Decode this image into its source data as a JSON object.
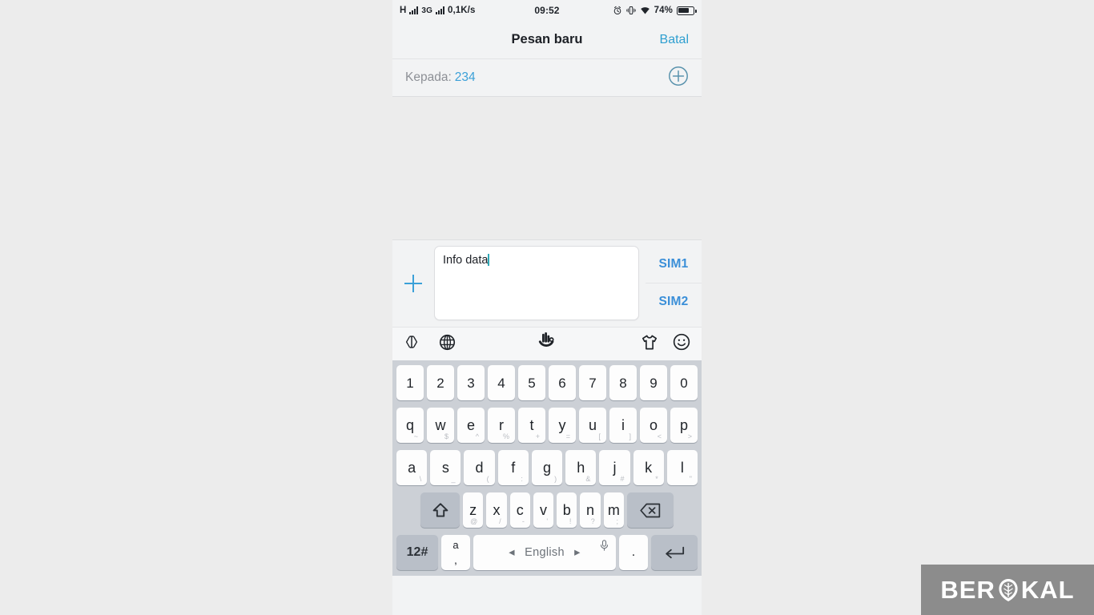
{
  "statusbar": {
    "network_type": "H",
    "network_gen": "3G",
    "data_rate": "0,1K/s",
    "clock": "09:52",
    "battery_percent": "74%",
    "battery_level": 74,
    "icons": [
      "signal-bars-icon",
      "signal-bars-icon",
      "alarm-clock-icon",
      "vibrate-icon",
      "wifi-icon",
      "battery-icon"
    ]
  },
  "titlebar": {
    "title": "Pesan baru",
    "cancel_label": "Batal"
  },
  "recipient": {
    "label": "Kepada:",
    "value": "234",
    "add_icon": "add-contact-circle-plus-icon"
  },
  "compose": {
    "attach_icon": "plus-attach-icon",
    "message_value": "Info data",
    "message_placeholder": "",
    "sim1_label": "SIM1",
    "sim2_label": "SIM2"
  },
  "keyboard_toolbar": {
    "items": [
      {
        "name": "cursor-move-icon",
        "glyph": "cursor"
      },
      {
        "name": "globe-language-icon",
        "glyph": "globe"
      },
      {
        "name": "handwriting-icon",
        "glyph": "hand"
      },
      {
        "name": "theme-tshirt-icon",
        "glyph": "shirt"
      },
      {
        "name": "emoji-smiley-icon",
        "glyph": "smiley"
      }
    ]
  },
  "keyboard": {
    "row_numbers": [
      {
        "main": "1",
        "sub": ""
      },
      {
        "main": "2",
        "sub": ""
      },
      {
        "main": "3",
        "sub": ""
      },
      {
        "main": "4",
        "sub": ""
      },
      {
        "main": "5",
        "sub": ""
      },
      {
        "main": "6",
        "sub": ""
      },
      {
        "main": "7",
        "sub": ""
      },
      {
        "main": "8",
        "sub": ""
      },
      {
        "main": "9",
        "sub": ""
      },
      {
        "main": "0",
        "sub": ""
      }
    ],
    "row_top": [
      {
        "main": "q",
        "sub": "~"
      },
      {
        "main": "w",
        "sub": "$"
      },
      {
        "main": "e",
        "sub": "^"
      },
      {
        "main": "r",
        "sub": "%"
      },
      {
        "main": "t",
        "sub": "+"
      },
      {
        "main": "y",
        "sub": "="
      },
      {
        "main": "u",
        "sub": "["
      },
      {
        "main": "i",
        "sub": "]"
      },
      {
        "main": "o",
        "sub": "<"
      },
      {
        "main": "p",
        "sub": ">"
      }
    ],
    "row_home": [
      {
        "main": "a",
        "sub": "\\"
      },
      {
        "main": "s",
        "sub": "_"
      },
      {
        "main": "d",
        "sub": "("
      },
      {
        "main": "f",
        "sub": ":"
      },
      {
        "main": "g",
        "sub": ")"
      },
      {
        "main": "h",
        "sub": "&"
      },
      {
        "main": "j",
        "sub": "#"
      },
      {
        "main": "k",
        "sub": "*"
      },
      {
        "main": "l",
        "sub": "\""
      }
    ],
    "row_bottom": [
      {
        "main": "z",
        "sub": "@"
      },
      {
        "main": "x",
        "sub": "/"
      },
      {
        "main": "c",
        "sub": "-"
      },
      {
        "main": "v",
        "sub": "'"
      },
      {
        "main": "b",
        "sub": "!"
      },
      {
        "main": "n",
        "sub": "?"
      },
      {
        "main": "m",
        "sub": ";"
      }
    ],
    "shift_label": "shift-arrow-icon",
    "backspace_label": "backspace-icon",
    "symbols_label": "12#",
    "comma_upper": "a",
    "comma_lower": ",",
    "space_label": "English",
    "space_prev": "◂",
    "space_next": "▸",
    "mic_label": "microphone-icon",
    "period_label": ".",
    "enter_label": "enter-return-icon"
  },
  "watermark": {
    "text_before": "BER",
    "text_after": "KAL",
    "logo_icon": "leaf-brain-logo-icon",
    "background_color": "#8c8c8c"
  },
  "colors": {
    "accent_blue": "#3ba0d8",
    "sim_blue": "#3b8fd8",
    "keyboard_bg": "#ccd0d6",
    "key_bg": "#fdfdfd",
    "fn_key_bg": "#b9bfc8",
    "screen_bg": "#f2f3f4",
    "body_bg": "#ececec"
  }
}
